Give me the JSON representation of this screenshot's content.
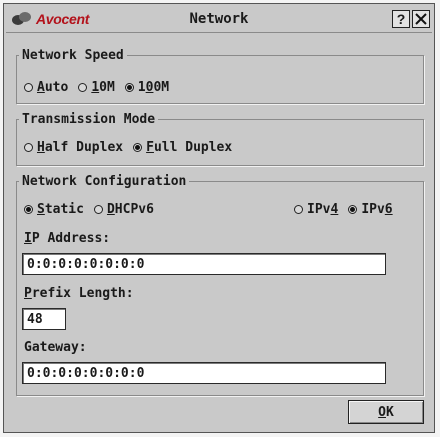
{
  "window": {
    "brand": "Avocent",
    "title": "Network",
    "help_label": "?",
    "close_icon": "close-icon"
  },
  "network_speed": {
    "legend": "Network Speed",
    "options": [
      {
        "pre": "",
        "key": "A",
        "post": "uto",
        "selected": false
      },
      {
        "pre": "",
        "key": "1",
        "post": "0M",
        "selected": false
      },
      {
        "pre": "1",
        "key": "0",
        "post": "0M",
        "selected": true
      }
    ]
  },
  "transmission_mode": {
    "legend": "Transmission Mode",
    "options": [
      {
        "pre": "",
        "key": "H",
        "post": "alf Duplex",
        "selected": false
      },
      {
        "pre": "",
        "key": "F",
        "post": "ull Duplex",
        "selected": true
      }
    ]
  },
  "network_configuration": {
    "legend": "Network Configuration",
    "addressing": [
      {
        "pre": "",
        "key": "S",
        "post": "tatic",
        "selected": true
      },
      {
        "pre": "",
        "key": "D",
        "post": "HCPv6",
        "selected": false
      }
    ],
    "ip_version": [
      {
        "pre": "IPv",
        "key": "4",
        "post": "",
        "selected": false
      },
      {
        "pre": "IPv",
        "key": "6",
        "post": "",
        "selected": true
      }
    ],
    "ip_address": {
      "label_key": "I",
      "label_rest": "P Address:",
      "value": "0:0:0:0:0:0:0:0"
    },
    "prefix_length": {
      "label_key": "P",
      "label_rest": "refix Length:",
      "value": "48"
    },
    "gateway": {
      "label_key": "",
      "label_rest": "Gateway:",
      "value": "0:0:0:0:0:0:0:0"
    }
  },
  "footer": {
    "ok_key": "O",
    "ok_rest": "K"
  }
}
